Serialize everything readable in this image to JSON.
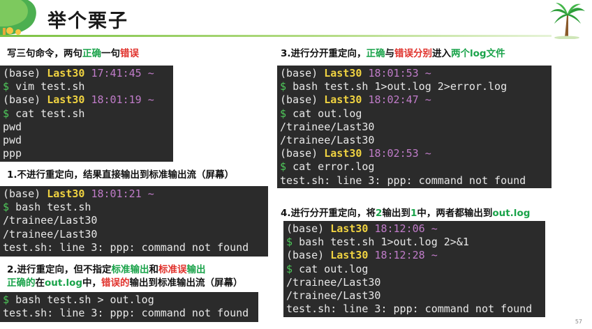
{
  "title": "举个栗子",
  "page_number": "57",
  "sections": {
    "intro": {
      "parts": [
        {
          "text": "写三句命令，两句",
          "color": "black"
        },
        {
          "text": "正确",
          "color": "green"
        },
        {
          "text": "一句",
          "color": "black"
        },
        {
          "text": "错误",
          "color": "red"
        }
      ]
    },
    "s1": {
      "parts": [
        {
          "text": "1.不进行重定向，结果直接输出到标准输出流（屏幕）",
          "color": "black"
        }
      ]
    },
    "s2_line1": {
      "parts": [
        {
          "text": "2.进行重定向，但不指定",
          "color": "black"
        },
        {
          "text": "标准输出",
          "color": "green"
        },
        {
          "text": "和",
          "color": "black"
        },
        {
          "text": "标准误",
          "color": "red"
        },
        {
          "text": "输出",
          "color": "green"
        }
      ]
    },
    "s2_line2": {
      "parts": [
        {
          "text": "正确的",
          "color": "green"
        },
        {
          "text": "在",
          "color": "black"
        },
        {
          "text": "out.log",
          "color": "green"
        },
        {
          "text": "中，",
          "color": "black"
        },
        {
          "text": "错误的",
          "color": "red"
        },
        {
          "text": "输出到标准输出流（屏幕）",
          "color": "black"
        }
      ]
    },
    "s3": {
      "parts": [
        {
          "text": "3.进行分开重定向，",
          "color": "black"
        },
        {
          "text": "正确",
          "color": "green"
        },
        {
          "text": "与",
          "color": "black"
        },
        {
          "text": "错误",
          "color": "red"
        },
        {
          "text": "分别",
          "color": "red"
        },
        {
          "text": "进入",
          "color": "black"
        },
        {
          "text": "两个log文件",
          "color": "green"
        }
      ]
    },
    "s4": {
      "parts": [
        {
          "text": "4.进行分开重定向，将",
          "color": "black"
        },
        {
          "text": "2",
          "color": "green"
        },
        {
          "text": "输出到",
          "color": "black"
        },
        {
          "text": "1",
          "color": "green"
        },
        {
          "text": "中，两者都输出到",
          "color": "black"
        },
        {
          "text": "out.log",
          "color": "green"
        }
      ]
    }
  },
  "terminals": {
    "t0": [
      {
        "type": "prompt",
        "env": "(base)",
        "user": "Last30",
        "time": "17:41:45",
        "tilde": "~"
      },
      {
        "type": "cmd",
        "dollar": "$",
        "text": "vim test.sh"
      },
      {
        "type": "prompt",
        "env": "(base)",
        "user": "Last30",
        "time": "18:01:19",
        "tilde": "~"
      },
      {
        "type": "cmd",
        "dollar": "$",
        "text": "cat test.sh"
      },
      {
        "type": "out",
        "text": "pwd"
      },
      {
        "type": "out",
        "text": "pwd"
      },
      {
        "type": "out",
        "text": "ppp"
      }
    ],
    "t1": [
      {
        "type": "prompt",
        "env": "(base)",
        "user": "Last30",
        "time": "18:01:21",
        "tilde": "~"
      },
      {
        "type": "cmd",
        "dollar": "$",
        "text": "bash test.sh"
      },
      {
        "type": "out",
        "text": "/trainee/Last30"
      },
      {
        "type": "out",
        "text": "/trainee/Last30"
      },
      {
        "type": "out",
        "text": "test.sh: line 3: ppp: command not found"
      }
    ],
    "t2": [
      {
        "type": "cmd",
        "dollar": "$",
        "text": "bash test.sh > out.log"
      },
      {
        "type": "out",
        "text": "test.sh: line 3: ppp: command not found"
      }
    ],
    "t3": [
      {
        "type": "prompt",
        "env": "(base)",
        "user": "Last30",
        "time": "18:01:53",
        "tilde": "~"
      },
      {
        "type": "cmd",
        "dollar": "$",
        "text": "bash test.sh 1>out.log 2>error.log"
      },
      {
        "type": "prompt",
        "env": "(base)",
        "user": "Last30",
        "time": "18:02:47",
        "tilde": "~"
      },
      {
        "type": "cmd",
        "dollar": "$",
        "text": "cat out.log"
      },
      {
        "type": "out",
        "text": "/trainee/Last30"
      },
      {
        "type": "out",
        "text": "/trainee/Last30"
      },
      {
        "type": "prompt",
        "env": "(base)",
        "user": "Last30",
        "time": "18:02:53",
        "tilde": "~"
      },
      {
        "type": "cmd",
        "dollar": "$",
        "text": "cat error.log"
      },
      {
        "type": "out",
        "text": "test.sh: line 3: ppp: command not found"
      }
    ],
    "t4": [
      {
        "type": "prompt",
        "env": "(base)",
        "user": "Last30",
        "time": "18:12:06",
        "tilde": "~"
      },
      {
        "type": "cmd",
        "dollar": "$",
        "text": "bash test.sh 1>out.log 2>&1"
      },
      {
        "type": "prompt",
        "env": "(base)",
        "user": "Last30",
        "time": "18:12:28",
        "tilde": "~"
      },
      {
        "type": "cmd",
        "dollar": "$",
        "text": "cat out.log"
      },
      {
        "type": "out",
        "text": "/trainee/Last30"
      },
      {
        "type": "out",
        "text": "/trainee/Last30"
      },
      {
        "type": "out",
        "text": "test.sh: line 3: ppp: command not found"
      }
    ]
  },
  "colors": {
    "green": "#1aa34a",
    "red": "#e0312b",
    "terminal_bg": "#2b2b2b",
    "prompt_user": "#f0d341",
    "prompt_time": "#c07cc9",
    "prompt_dollar": "#4ec85a"
  }
}
